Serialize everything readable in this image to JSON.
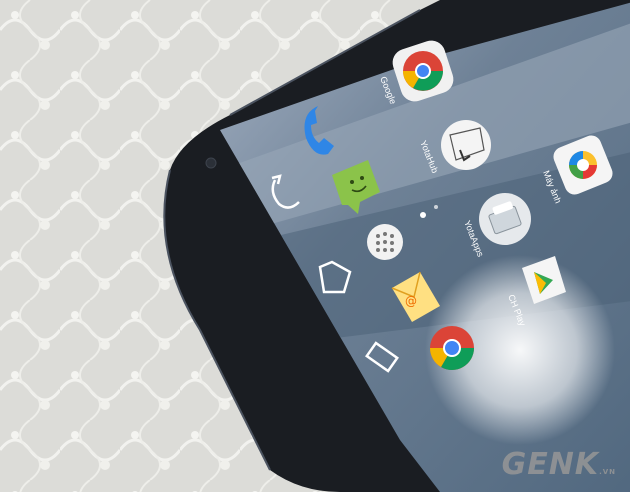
{
  "apps": [
    {
      "label": "Google",
      "icon": "google-chrome-icon"
    },
    {
      "label": "YotaHub",
      "icon": "yotahub-icon"
    },
    {
      "label": "Máy ảnh",
      "icon": "camera-icon"
    },
    {
      "label": "YotaApps",
      "icon": "yotaapps-icon"
    },
    {
      "label": "CH Play",
      "icon": "play-store-icon"
    }
  ],
  "dock": [
    "phone-icon",
    "messaging-icon",
    "app-drawer-icon",
    "email-icon",
    "chrome-icon"
  ],
  "nav": [
    "back-icon",
    "home-icon",
    "recents-icon"
  ],
  "watermark": {
    "brand": "GENK",
    "suffix": ".VN"
  },
  "colors": {
    "phone_body": "#1a1d22",
    "screen": "#7f8ea0",
    "background": "#d9dad6"
  }
}
